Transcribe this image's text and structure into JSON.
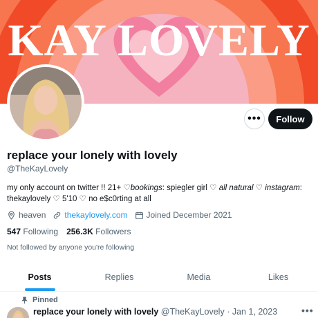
{
  "banner": {
    "text": "KAY LOVELY"
  },
  "profile": {
    "display_name": "replace your lonely with lovely",
    "handle": "@TheKayLovely",
    "bio": {
      "p1": "my only account on twitter !! 21+ ♡",
      "p2": "bookings",
      "p3": ": spiegler girl ♡ ",
      "p4": "all natural",
      "p5": " ♡ ",
      "p6": "instagram",
      "p7": ": thekaylovely ♡ 5'10 ♡ no e$c0rting at all"
    },
    "location": "heaven",
    "website": "thekaylovely.com",
    "joined": "Joined December 2021",
    "following_count": "547",
    "following_label": "Following",
    "followers_count": "256.3K",
    "followers_label": "Followers",
    "not_followed": "Not followed by anyone you're following"
  },
  "actions": {
    "more_label": "•••",
    "follow_label": "Follow"
  },
  "tabs": [
    {
      "label": "Posts",
      "active": true
    },
    {
      "label": "Replies",
      "active": false
    },
    {
      "label": "Media",
      "active": false
    },
    {
      "label": "Likes",
      "active": false
    }
  ],
  "pinned_tweet": {
    "pinned_label": "Pinned",
    "author_name": "replace your lonely with lovely",
    "author_handle": "@TheKayLovely",
    "separator": "·",
    "date": "Jan 1, 2023",
    "more_label": "•••"
  },
  "colors": {
    "accent": "#1d9bf0",
    "follow_button": "#0f1419",
    "secondary_text": "#536471",
    "banner_rings": [
      "#f04a28",
      "#f7764f",
      "#fa9c86",
      "#f5b3bf",
      "#f27fa0"
    ]
  },
  "icons": [
    "location-icon",
    "link-icon",
    "calendar-icon",
    "pin-icon"
  ]
}
